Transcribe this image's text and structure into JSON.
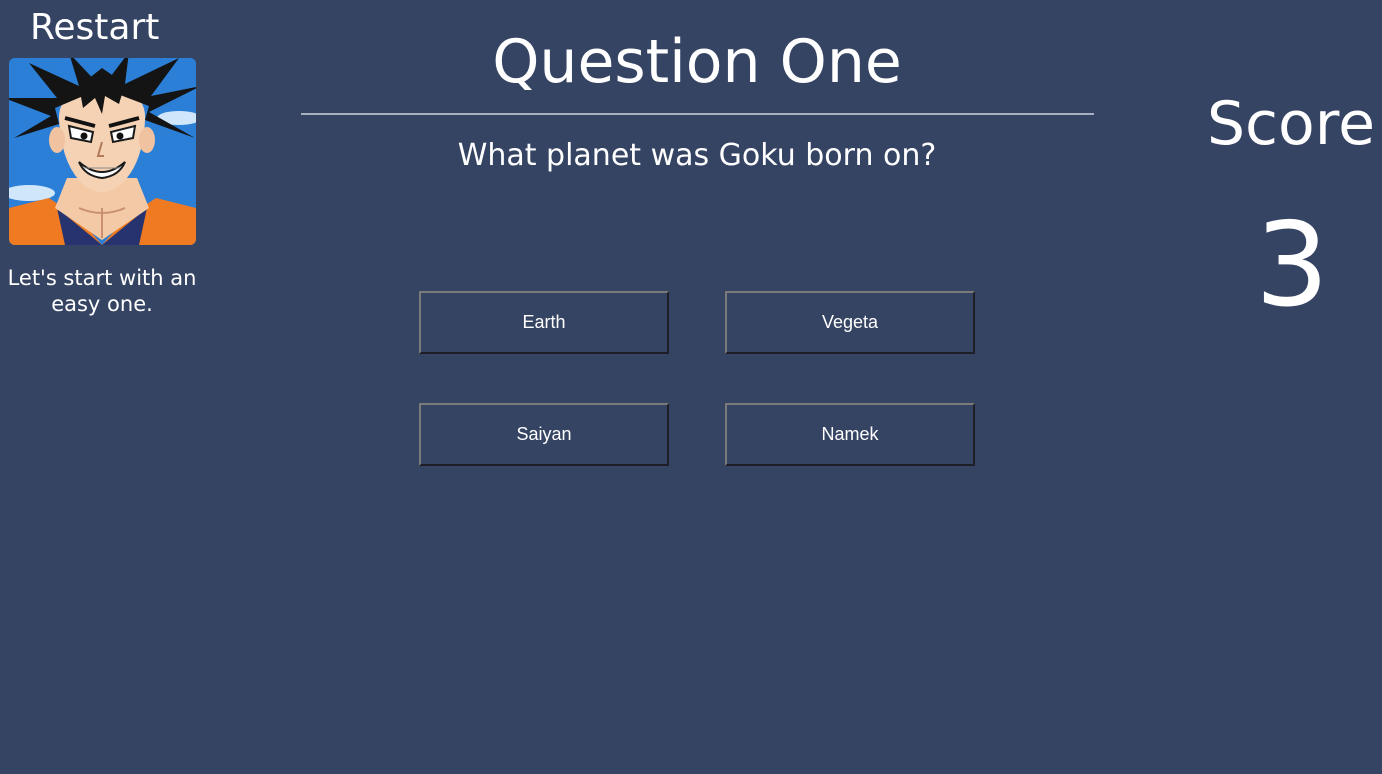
{
  "sidebar": {
    "restart_label": "Restart",
    "portrait_icon": "goku-portrait",
    "hint": "Let's start with an easy one."
  },
  "question": {
    "title": "Question One",
    "text": "What planet was Goku born on?"
  },
  "answers": [
    {
      "label": "Earth"
    },
    {
      "label": "Vegeta"
    },
    {
      "label": "Saiyan"
    },
    {
      "label": "Namek"
    }
  ],
  "score": {
    "label": "Score",
    "value": "3"
  },
  "colors": {
    "background": "#364464",
    "text": "#ffffff",
    "divider": "#a9b0c2"
  }
}
